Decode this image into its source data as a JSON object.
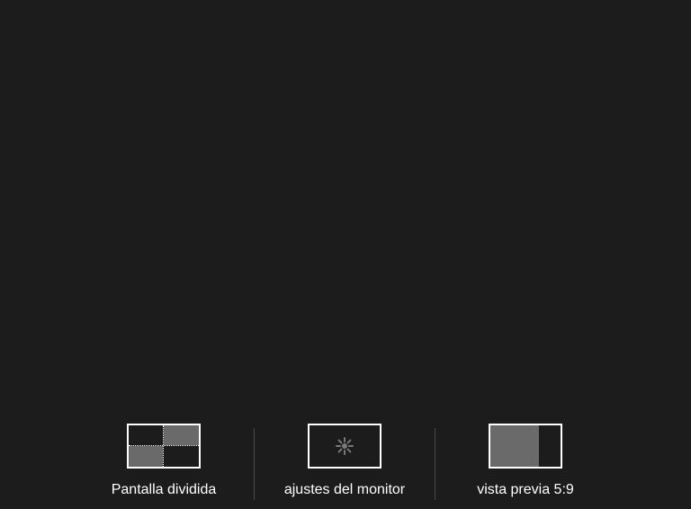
{
  "bottom_menu": {
    "options": [
      {
        "label": "Pantalla dividida",
        "icon": "split-screen-icon"
      },
      {
        "label": "ajustes del monitor",
        "icon": "gear-icon"
      },
      {
        "label": "vista previa 5:9",
        "icon": "preview-5-9-icon"
      }
    ]
  },
  "colors": {
    "background": "#1c1c1c",
    "icon_outline": "#ffffff",
    "icon_fill": "#6a6a6a",
    "divider": "#4a4a4a",
    "text": "#ffffff"
  }
}
